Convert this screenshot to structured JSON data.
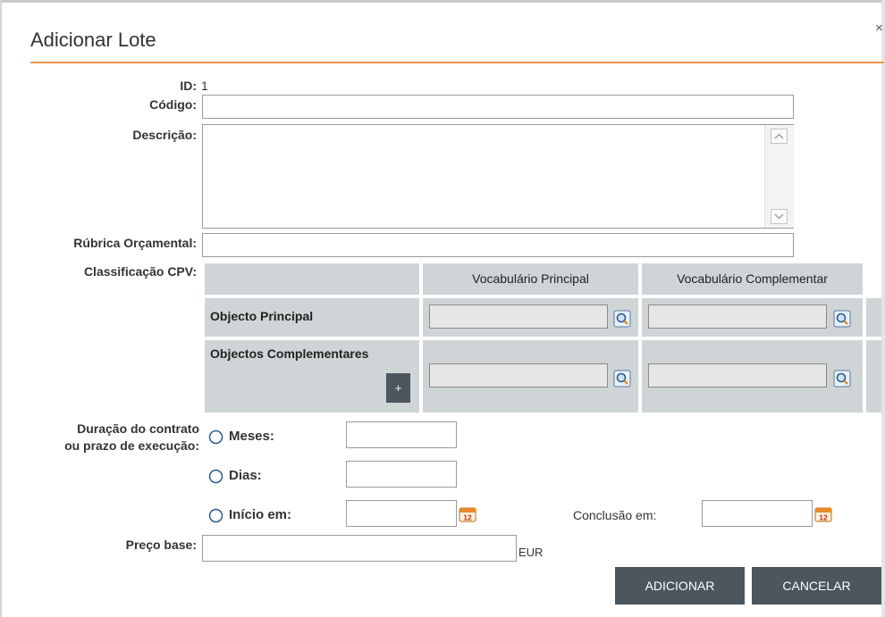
{
  "dialog": {
    "title": "Adicionar Lote",
    "close_glyph": "×"
  },
  "form": {
    "id_label": "ID:",
    "id_value": "1",
    "codigo_label": "Código:",
    "codigo_value": "",
    "descricao_label": "Descrição:",
    "descricao_value": "",
    "rubrica_label": "Rúbrica Orçamental:",
    "rubrica_value": "",
    "cpv": {
      "label": "Classificação CPV:",
      "col_principal": "Vocabulário Principal",
      "col_complementar": "Vocabulário Complementar",
      "row_principal": "Objecto Principal",
      "row_complementares": "Objectos Complementares",
      "add_label": "+",
      "search_icon": "search-icon"
    },
    "duracao": {
      "label_line1": "Duração do contrato",
      "label_line2": "ou prazo de execução:",
      "meses_label": "Meses:",
      "dias_label": "Dias:",
      "inicio_label": "Início em:",
      "conclusao_label": "Conclusão em:",
      "calendar_icon": "calendar-icon",
      "calendar_day": "12"
    },
    "preco": {
      "label": "Preço base:",
      "currency": "EUR",
      "value": ""
    }
  },
  "actions": {
    "add_label": "ADICIONAR",
    "cancel_label": "CANCELAR"
  },
  "colors": {
    "accent": "#f0924a",
    "button_bg": "#4b565f",
    "table_bg": "#cfd4d6"
  }
}
